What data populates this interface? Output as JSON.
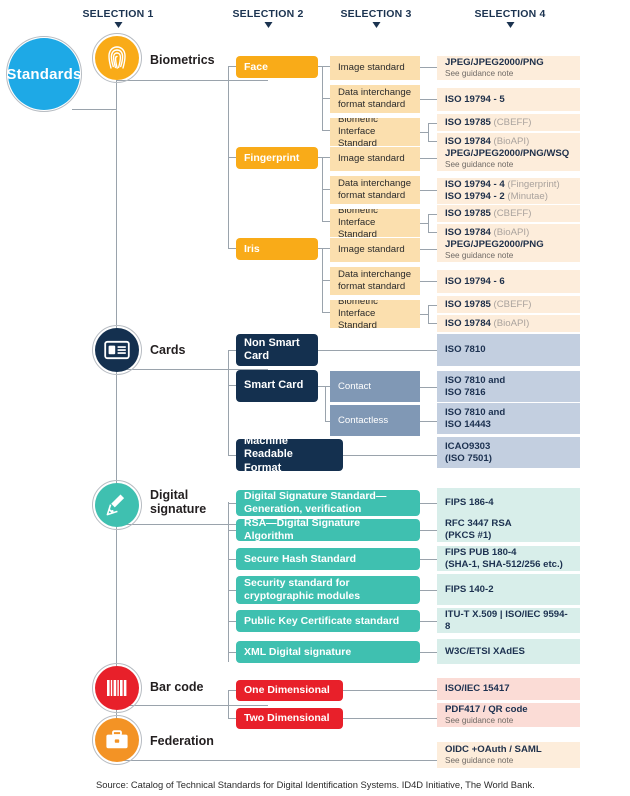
{
  "headers": [
    {
      "label": "SELECTION 1"
    },
    {
      "label": "SELECTION 2"
    },
    {
      "label": "SELECTION 3"
    },
    {
      "label": "SELECTION 4"
    }
  ],
  "root": {
    "label": "Standards",
    "color": "#1ea9e6"
  },
  "categories": [
    {
      "label": "Biometrics",
      "icon": "fingerprint-icon",
      "color": "#f9ab18"
    },
    {
      "label": "Cards",
      "icon": "id-card-icon",
      "color": "#14304f"
    },
    {
      "label": "Digital\nsignature",
      "icon": "signature-pen-icon",
      "color": "#3fc0b0"
    },
    {
      "label": "Bar code",
      "icon": "barcode-icon",
      "color": "#e8202a"
    },
    {
      "label": "Federation",
      "icon": "briefcase-icon",
      "color": "#f39325"
    }
  ],
  "biometrics": {
    "modalities": [
      {
        "name": "Face",
        "rows": [
          {
            "label": "Image standard",
            "values": [
              {
                "lead": "JPEG/JPEG2000/PNG",
                "note": "See guidance note"
              }
            ]
          },
          {
            "label": "Data interchange\nformat standard",
            "values": [
              {
                "lead": "ISO 19794 - 5",
                "tail": ""
              }
            ]
          },
          {
            "label": "Biometric Interface\nStandard",
            "values": [
              {
                "lead": "ISO 19785",
                "tail": "(CBEFF)"
              },
              {
                "lead": "ISO 19784",
                "tail": "(BioAPI)"
              }
            ]
          }
        ]
      },
      {
        "name": "Fingerprint",
        "rows": [
          {
            "label": "Image standard",
            "values": [
              {
                "lead": "JPEG/JPEG2000/PNG/WSQ",
                "note": "See guidance note"
              }
            ]
          },
          {
            "label": "Data interchange\nformat standard",
            "values": [
              {
                "lead": "ISO 19794 - 4",
                "tail": "(Fingerprint)"
              },
              {
                "lead": "ISO 19794 - 2",
                "tail": "(Minutae)"
              }
            ]
          },
          {
            "label": "Biometric Interface\nStandard",
            "values": [
              {
                "lead": "ISO 19785",
                "tail": "(CBEFF)"
              },
              {
                "lead": "ISO 19784",
                "tail": "(BioAPI)"
              }
            ]
          }
        ]
      },
      {
        "name": "Iris",
        "rows": [
          {
            "label": "Image standard",
            "values": [
              {
                "lead": "JPEG/JPEG2000/PNG",
                "note": "See guidance note"
              }
            ]
          },
          {
            "label": "Data interchange\nformat standard",
            "values": [
              {
                "lead": "ISO 19794 - 6",
                "tail": ""
              }
            ]
          },
          {
            "label": "Biometric Interface\nStandard",
            "values": [
              {
                "lead": "ISO 19785",
                "tail": "(CBEFF)"
              },
              {
                "lead": "ISO 19784",
                "tail": "(BioAPI)"
              }
            ]
          }
        ]
      }
    ]
  },
  "cards": {
    "non_smart": {
      "label": "Non Smart\nCard",
      "value": {
        "lead": "ISO 7810"
      }
    },
    "smart": {
      "label": "Smart Card",
      "children": [
        {
          "label": "Contact",
          "value": {
            "lead": "ISO 7810 and",
            "line2": "ISO 7816"
          }
        },
        {
          "label": "Contactless",
          "value": {
            "lead": "ISO 7810 and",
            "line2": "ISO 14443"
          }
        }
      ]
    },
    "mrz": {
      "label": "Machine Readable\nFormat",
      "value": {
        "lead": "ICAO9303",
        "line2": "(ISO 7501)"
      }
    }
  },
  "digital_signature": {
    "rows": [
      {
        "label": "Digital Signature Standard—\nGeneration, verification",
        "value": {
          "lead": "FIPS 186-4"
        }
      },
      {
        "label": "RSA—Digital Signature Algorithm",
        "value": {
          "lead": "RFC 3447 RSA",
          "line2": "(PKCS #1)"
        }
      },
      {
        "label": "Secure Hash Standard",
        "value": {
          "lead": "FIPS PUB 180-4",
          "line2": "(SHA-1, SHA-512/256 etc.)"
        }
      },
      {
        "label": "Security standard for\ncryptographic modules",
        "value": {
          "lead": "FIPS 140-2"
        }
      },
      {
        "label": "Public Key Certificate standard",
        "value": {
          "lead": "ITU-T X.509  |  ISO/IEC 9594-8"
        }
      },
      {
        "label": "XML Digital signature",
        "value": {
          "lead": "W3C/ETSI  XAdES"
        }
      }
    ]
  },
  "barcode": {
    "rows": [
      {
        "label": "One Dimensional",
        "value": {
          "lead": "ISO/IEC 15417"
        }
      },
      {
        "label": "Two Dimensional",
        "value": {
          "lead": "PDF417 / QR code",
          "note": "See guidance note"
        }
      }
    ]
  },
  "federation": {
    "value": {
      "lead": "OIDC +OAuth / SAML",
      "note": "See guidance note"
    }
  },
  "source": "Source: Catalog of Technical Standards for Digital Identification Systems. ID4D Initiative, The World Bank."
}
